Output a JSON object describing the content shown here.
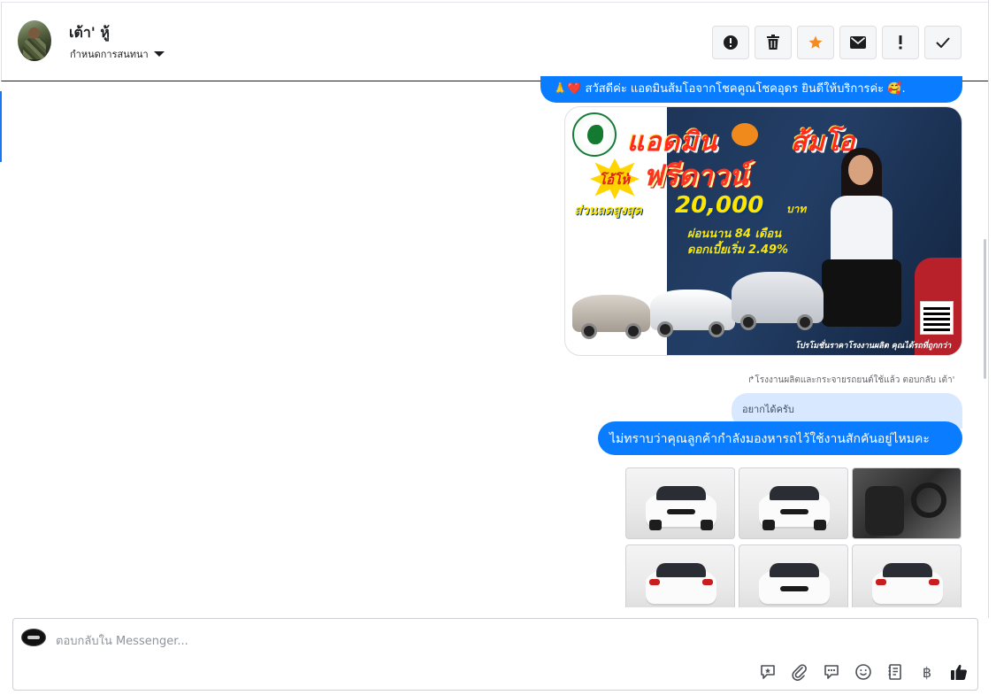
{
  "conversation": {
    "contact_name": "เต้า' หู้",
    "assign_label": "กำหนดการสนทนา"
  },
  "toolbar": {
    "buttons": [
      {
        "name": "spam",
        "icon": "alert-circle-icon"
      },
      {
        "name": "delete",
        "icon": "trash-icon"
      },
      {
        "name": "star",
        "icon": "star-icon",
        "color": "#f48c22"
      },
      {
        "name": "mark-unread",
        "icon": "envelope-icon"
      },
      {
        "name": "follow-up",
        "icon": "exclamation-icon"
      },
      {
        "name": "done",
        "icon": "check-icon"
      }
    ]
  },
  "messages": {
    "greeting": "🙏❤️ สวัสดีค่ะ แอดมินส้มโอจากโชคคูณโชคอุดร ยินดีให้บริการค่ะ 🥰.",
    "promo_image": {
      "headline_left": "แอดมิน",
      "headline_right": "ส้มโอ",
      "badge": "โอ้โห้",
      "offer": "ฟรีดาวน์",
      "discount_label": "ส่วนลดสูงสุด",
      "discount_amount": "20,000",
      "discount_unit": "บาท",
      "installment": "ผ่อนนาน 84 เดือน",
      "interest": "ดอกเบี้ยเริ่ม 2.49%",
      "footer": "โปรโมชั่นราคาโรงงานผลิต คุณได้รถที่ถูกกว่า"
    },
    "reply_note": "โรงงานผลิตและกระจายรถยนต์ใช้แล้ว ตอบกลับ เต้า'",
    "quoted_reply": "อยากได้ครับ",
    "question": "ไม่ทราบว่าคุณลูกค้ากำลังมองหารถไว้ใช้งานสักคันอยู่ไหมคะ",
    "photo_tiles": [
      "car-front",
      "car-front",
      "car-interior",
      "car-rear",
      "car-front",
      "car-rear"
    ]
  },
  "composer": {
    "placeholder": "ตอบกลับใน Messenger...",
    "icons": [
      "saved-reply-icon",
      "attachment-icon",
      "chat-bubble-icon",
      "emoji-icon",
      "notes-icon",
      "baht-icon",
      "thumbs-up-icon"
    ],
    "baht_symbol": "฿"
  },
  "colors": {
    "accent": "#0a7cff",
    "quote_bg": "#d8e8ff",
    "star": "#f48c22"
  }
}
